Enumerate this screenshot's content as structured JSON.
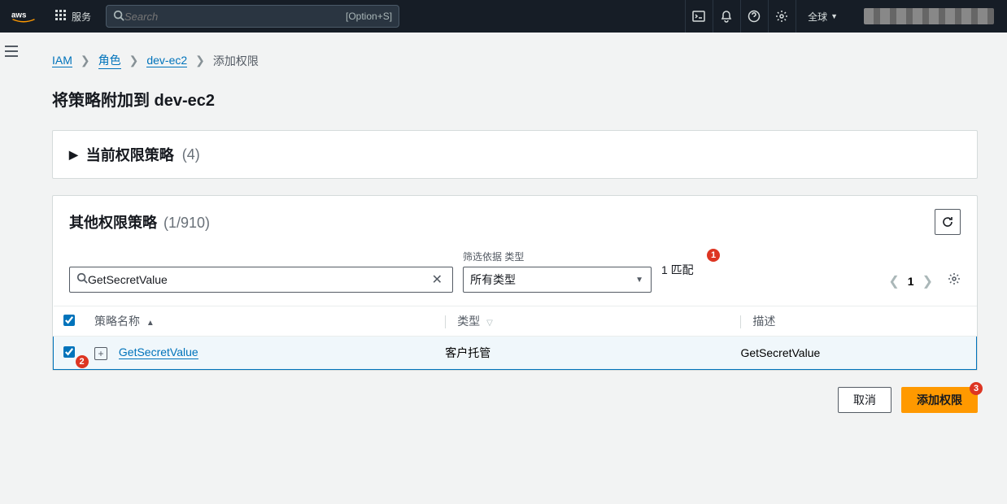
{
  "topnav": {
    "services_label": "服务",
    "search_placeholder": "Search",
    "search_hotkey": "[Option+S]",
    "region": "全球"
  },
  "breadcrumb": {
    "iam": "IAM",
    "roles": "角色",
    "role": "dev-ec2",
    "current": "添加权限"
  },
  "page_title": "将策略附加到 dev-ec2",
  "current_panel": {
    "title": "当前权限策略",
    "count": "(4)"
  },
  "other_panel": {
    "title": "其他权限策略",
    "count": "(1/910)",
    "search_value": "GetSecretValue",
    "filter_label": "筛选依据 类型",
    "filter_selected": "所有类型",
    "match_text": "1 匹配",
    "page_number": "1"
  },
  "table": {
    "headers": {
      "name": "策略名称",
      "type": "类型",
      "desc": "描述"
    },
    "row": {
      "name": "GetSecretValue",
      "type": "客户托管",
      "desc": "GetSecretValue"
    }
  },
  "actions": {
    "cancel": "取消",
    "add": "添加权限"
  },
  "badges": {
    "one": "1",
    "two": "2",
    "three": "3"
  }
}
